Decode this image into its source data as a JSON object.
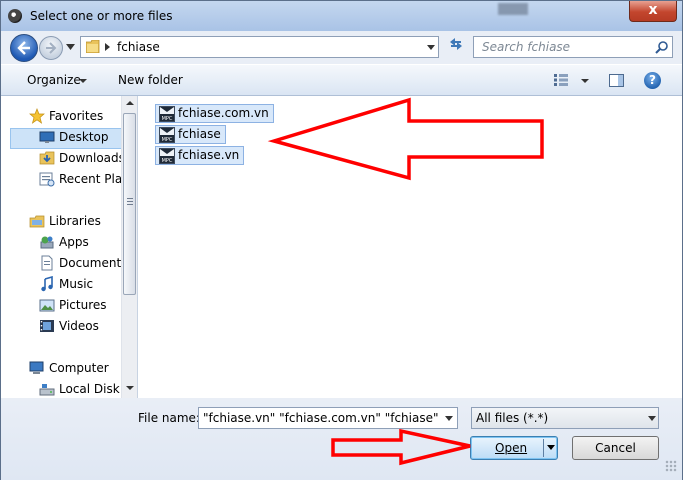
{
  "window": {
    "title": "Select one or more files",
    "close_label": "x"
  },
  "address": {
    "crumb": "fchiase"
  },
  "search": {
    "placeholder": "Search fchiase"
  },
  "toolbar": {
    "organize": "Organize",
    "new_folder": "New folder",
    "help": "?"
  },
  "nav": {
    "items": [
      {
        "label": "Favorites",
        "icon": "star-icon"
      },
      {
        "label": "Desktop",
        "icon": "desktop-icon"
      },
      {
        "label": "Downloads",
        "icon": "downloads-icon"
      },
      {
        "label": "Recent Plac",
        "icon": "recent-places-icon"
      },
      {
        "label": "Libraries",
        "icon": "libraries-icon"
      },
      {
        "label": "Apps",
        "icon": "apps-icon"
      },
      {
        "label": "Documents",
        "icon": "documents-icon"
      },
      {
        "label": "Music",
        "icon": "music-icon"
      },
      {
        "label": "Pictures",
        "icon": "pictures-icon"
      },
      {
        "label": "Videos",
        "icon": "videos-icon"
      },
      {
        "label": "Computer",
        "icon": "computer-icon"
      },
      {
        "label": "Local Disk (",
        "icon": "local-disk-icon"
      }
    ]
  },
  "files": [
    {
      "name": "fchiase.com.vn",
      "icon": "mpc-file-icon"
    },
    {
      "name": "fchiase",
      "icon": "mpc-file-icon"
    },
    {
      "name": "fchiase.vn",
      "icon": "mpc-file-icon"
    }
  ],
  "bottom": {
    "file_name_label": "File name:",
    "file_name_value": "\"fchiase.vn\" \"fchiase.com.vn\" \"fchiase\"",
    "filter_value": "All files (*.*)",
    "open_label": "Open",
    "cancel_label": "Cancel"
  },
  "colors": {
    "annotation_arrow": "#ff0000",
    "selection": "#cde3f8"
  }
}
